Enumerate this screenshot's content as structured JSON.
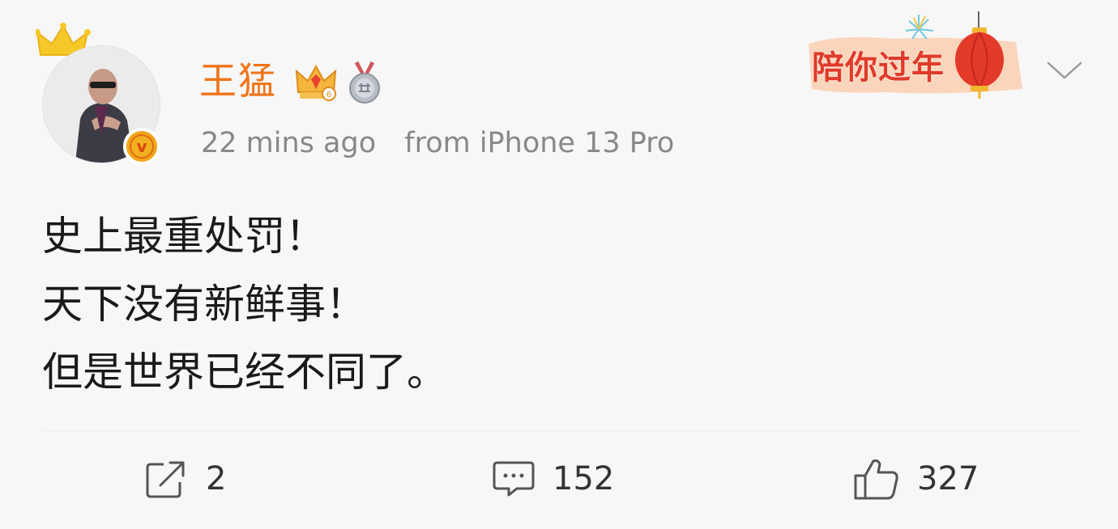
{
  "user": {
    "name": "王猛",
    "avatar_icon": "avatar-photo",
    "verified_badge": "v",
    "crown_icon": "crown-icon",
    "vip_icon": "vip-crown-icon",
    "medal_icon": "medal-icon",
    "name_color": "#f07317"
  },
  "meta": {
    "time": "22 mins ago",
    "source": "from iPhone 13 Pro"
  },
  "promo": {
    "text": "陪你过年",
    "icon": "lantern-icon"
  },
  "post": {
    "lines": [
      "史上最重处罚！",
      "天下没有新鲜事！",
      "但是世界已经不同了。"
    ]
  },
  "actions": {
    "repost": {
      "icon": "repost-icon",
      "count": "2"
    },
    "comment": {
      "icon": "comment-icon",
      "count": "152"
    },
    "like": {
      "icon": "like-icon",
      "count": "327"
    }
  }
}
